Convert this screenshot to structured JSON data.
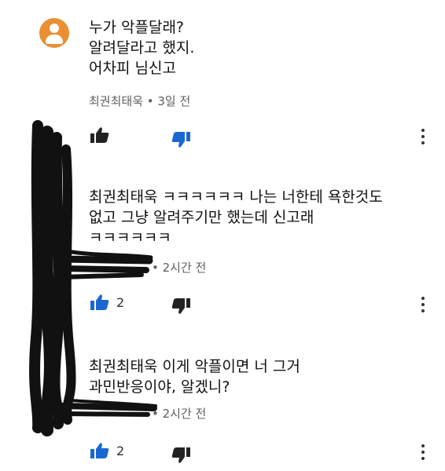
{
  "comments": [
    {
      "lines": [
        "누가 악플달래?",
        "알려달라고 했지.",
        "어차피 님신고"
      ],
      "meta": "최권최태욱 • 3일 전",
      "like_count": ""
    },
    {
      "lines": [
        "최권최태욱 ㅋㅋㅋㅋㅋㅋ 나는 너한테 욕한것도",
        "없고 그냥 알려주기만 했는데 신고래",
        "ㅋㅋㅋㅋㅋㅋ"
      ],
      "meta": "• 2시간 전",
      "like_count": "2"
    },
    {
      "lines": [
        "최권최태욱 이게 악플이면 너 그거",
        "과민반응이야, 알겠니?"
      ],
      "meta": "• 2시간 전",
      "like_count": "2"
    }
  ],
  "colors": {
    "avatar": "#ea8f32",
    "active_blue": "#1a67d2",
    "icon_dark": "#222222",
    "meta_gray": "#606060"
  },
  "icons": [
    "thumbs-up-icon",
    "thumbs-down-icon",
    "more-vertical-icon",
    "avatar-icon"
  ]
}
